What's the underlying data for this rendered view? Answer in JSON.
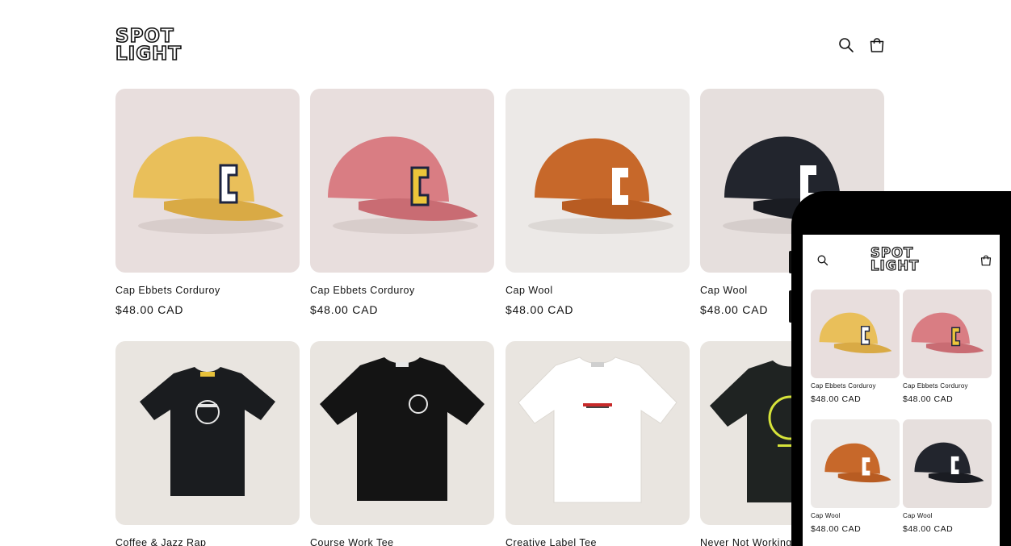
{
  "store": {
    "logo_line1": "SPOT",
    "logo_line2": "LIGHT"
  },
  "header": {
    "search_icon": "search-icon",
    "cart_icon": "cart-icon"
  },
  "products": [
    {
      "title": "Cap Ebbets Corduroy",
      "price": "$48.00 CAD",
      "type": "cap",
      "color": "#e9bf5a",
      "letter_fill": "#ffffff",
      "bg": "#e8dedd"
    },
    {
      "title": "Cap Ebbets Corduroy",
      "price": "$48.00 CAD",
      "type": "cap",
      "color": "#d97d83",
      "letter_fill": "#ecc53a",
      "bg": "#e8dedd"
    },
    {
      "title": "Cap Wool",
      "price": "$48.00 CAD",
      "type": "cap",
      "color": "#c7682a",
      "letter_fill": "#ffffff",
      "bg": "#ece9e7"
    },
    {
      "title": "Cap Wool",
      "price": "$48.00 CAD",
      "type": "cap",
      "color": "#22252d",
      "letter_fill": "#ffffff",
      "bg": "#e6dfdd"
    },
    {
      "title": "Coffee & Jazz Rap",
      "price": "",
      "type": "tee",
      "color": "#1a1c1f",
      "bg": "#e9e5e0"
    },
    {
      "title": "Course Work Tee",
      "price": "",
      "type": "tee",
      "color": "#141414",
      "bg": "#e9e5e0"
    },
    {
      "title": "Creative Label Tee",
      "price": "",
      "type": "tee",
      "color": "#ffffff",
      "bg": "#e9e5e0"
    },
    {
      "title": "Never Not Working",
      "price": "",
      "type": "tee",
      "color": "#1f2322",
      "bg": "#e9e5e0"
    }
  ],
  "mobile": {
    "logo_line1": "SPOT",
    "logo_line2": "LIGHT",
    "products": [
      {
        "title": "Cap Ebbets Corduroy",
        "price": "$48.00 CAD"
      },
      {
        "title": "Cap Ebbets Corduroy",
        "price": "$48.00 CAD"
      },
      {
        "title": "Cap Wool",
        "price": "$48.00 CAD"
      },
      {
        "title": "Cap Wool",
        "price": "$48.00 CAD"
      }
    ]
  }
}
